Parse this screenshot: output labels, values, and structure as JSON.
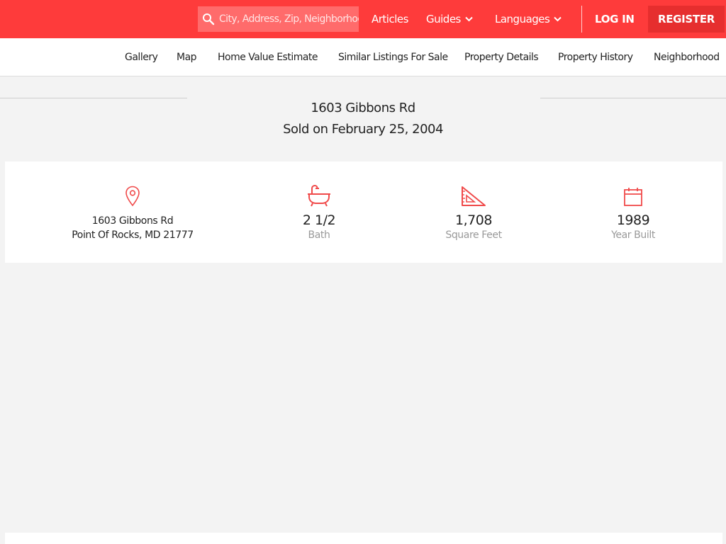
{
  "header": {
    "search": {
      "placeholder": "City, Address, Zip, Neighborhood"
    },
    "nav": [
      {
        "label": "Articles"
      },
      {
        "label": "Guides"
      },
      {
        "label": "Languages"
      }
    ],
    "login_label": "LOG IN",
    "register_label": "REGISTER"
  },
  "subnav": {
    "items": [
      "Gallery",
      "Map",
      "Home Value Estimate",
      "Similar Listings For Sale",
      "Property Details",
      "Property History",
      "Neighborhood"
    ]
  },
  "listing": {
    "title": "1603 Gibbons Rd",
    "subtitle": "Sold on February 25, 2004"
  },
  "stats": {
    "address_line1": "1603 Gibbons Rd",
    "address_line2": "Point Of Rocks, MD 21777",
    "bath_value": "2 1/2",
    "bath_label": "Bath",
    "sqft_value": "1,708",
    "sqft_label": "Square Feet",
    "year_value": "1989",
    "year_label": "Year Built"
  },
  "icons": {
    "search": "search-icon",
    "chevron": "chevron-down-icon",
    "location": "map-pin-icon",
    "bath": "bathtub-icon",
    "sqft": "set-square-icon",
    "year": "calendar-icon"
  },
  "colors": {
    "brand": "#fe3b3b",
    "search_bg": "#ff6b6b",
    "register_bg": "#e62e2e",
    "icon_red": "#f04a4a"
  }
}
